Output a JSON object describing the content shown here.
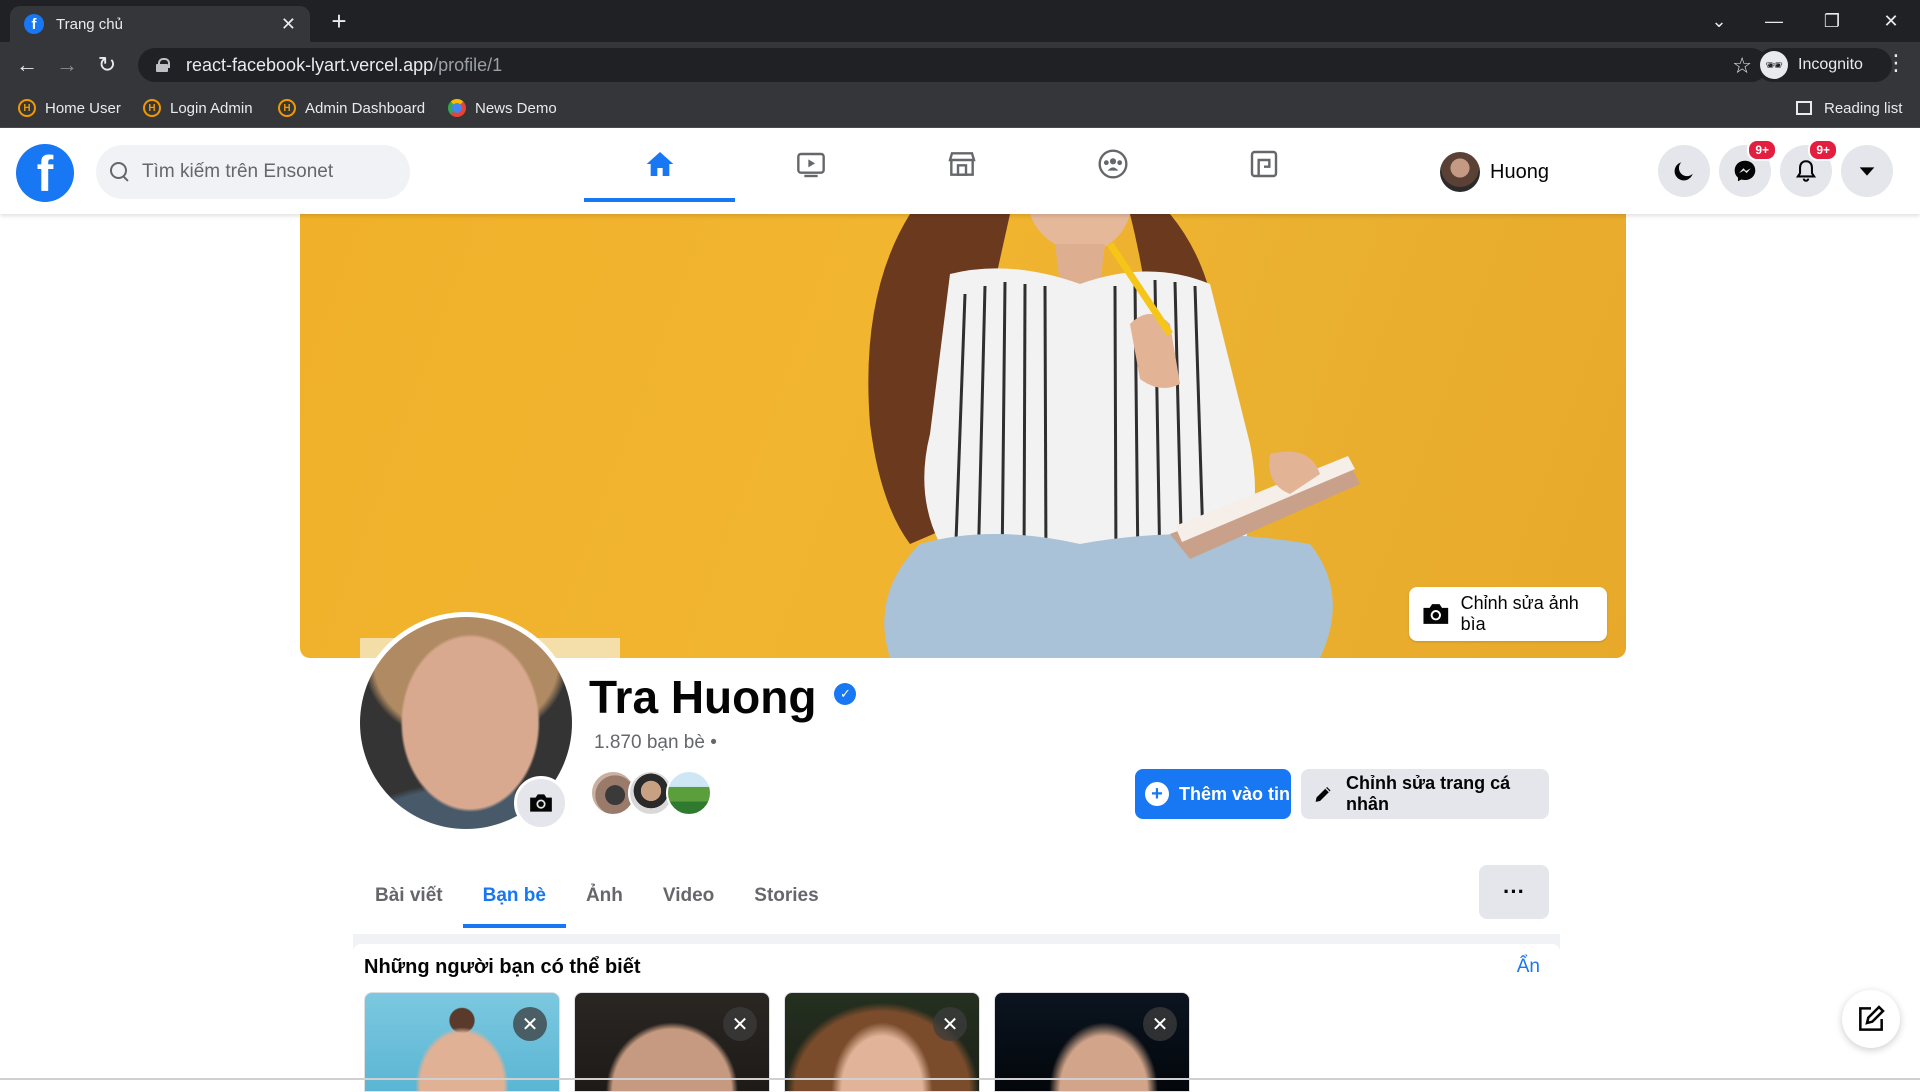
{
  "browser": {
    "tab_title": "Trang chủ",
    "url_host": "react-facebook-lyart.vercel.app",
    "url_path": "/profile/1",
    "incognito_label": "Incognito",
    "bookmarks": [
      "Home User",
      "Login Admin",
      "Admin Dashboard",
      "News Demo"
    ],
    "reading_list": "Reading list"
  },
  "header": {
    "search_placeholder": "Tìm kiếm trên Ensonet",
    "user_name": "Huong",
    "messenger_badge": "9+",
    "notifications_badge": "9+",
    "nav_icons": [
      "home-icon",
      "watch-icon",
      "marketplace-icon",
      "groups-icon",
      "gaming-icon"
    ],
    "active_nav": "home"
  },
  "profile": {
    "edit_cover_label": "Chỉnh sửa ảnh bìa",
    "name": "Tra Huong",
    "friend_count": "1.870 bạn bè •",
    "add_story_label": "Thêm vào tin",
    "edit_profile_label": "Chỉnh sửa trang cá nhân",
    "tabs": [
      "Bài viết",
      "Bạn bè",
      "Ảnh",
      "Video",
      "Stories"
    ],
    "active_tab": "Bạn bè",
    "more_label": "···"
  },
  "people_you_may_know": {
    "title": "Những người bạn có thể biết",
    "hide_label": "Ẩn",
    "close_label": "✕"
  },
  "colors": {
    "brand": "#1877f2",
    "badge": "#e41e3f",
    "cover": "#f2b52f"
  }
}
